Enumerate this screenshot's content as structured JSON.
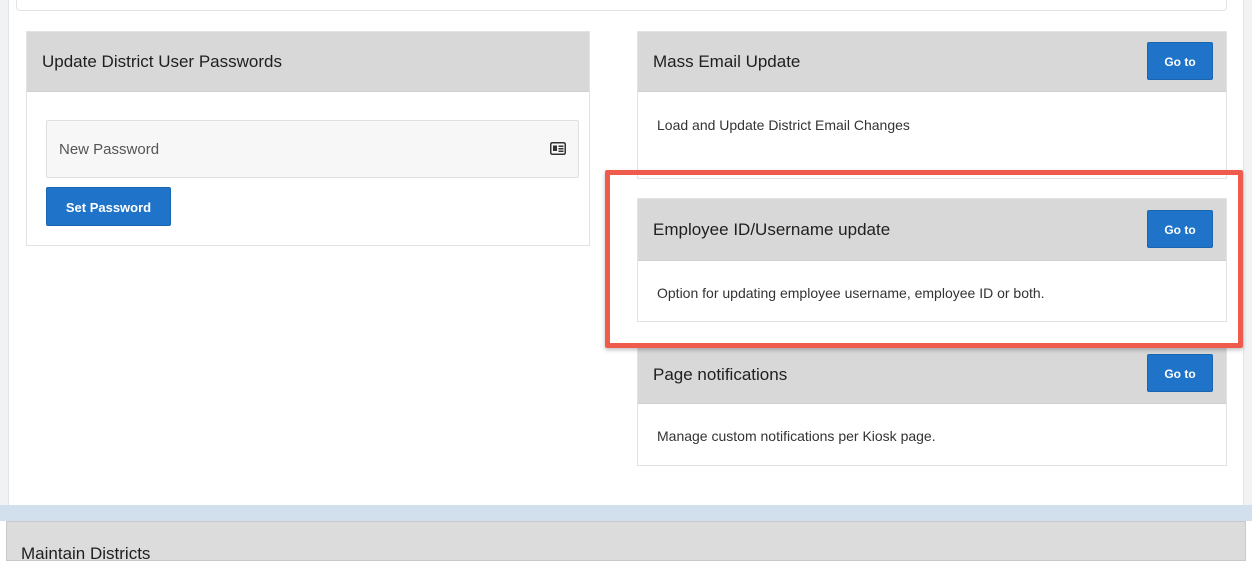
{
  "password_card": {
    "title": "Update District User Passwords",
    "input_placeholder": "New Password",
    "input_value": "",
    "button_label": "Set Password",
    "input_icon": "id-card-icon"
  },
  "cards": [
    {
      "title": "Mass Email Update",
      "button_label": "Go to",
      "description": "Load and Update District Email Changes"
    },
    {
      "title": "Employee ID/Username update",
      "button_label": "Go to",
      "description": "Option for updating employee username, employee ID or both."
    },
    {
      "title": "Page notifications",
      "button_label": "Go to",
      "description": "Manage custom notifications per Kiosk page."
    }
  ],
  "bottom_section": {
    "title": "Maintain Districts"
  },
  "colors": {
    "primary_button": "#1f73c8",
    "card_header": "#d8d8d8",
    "highlight": "#ef5b4c",
    "separator": "#d2dfec"
  }
}
